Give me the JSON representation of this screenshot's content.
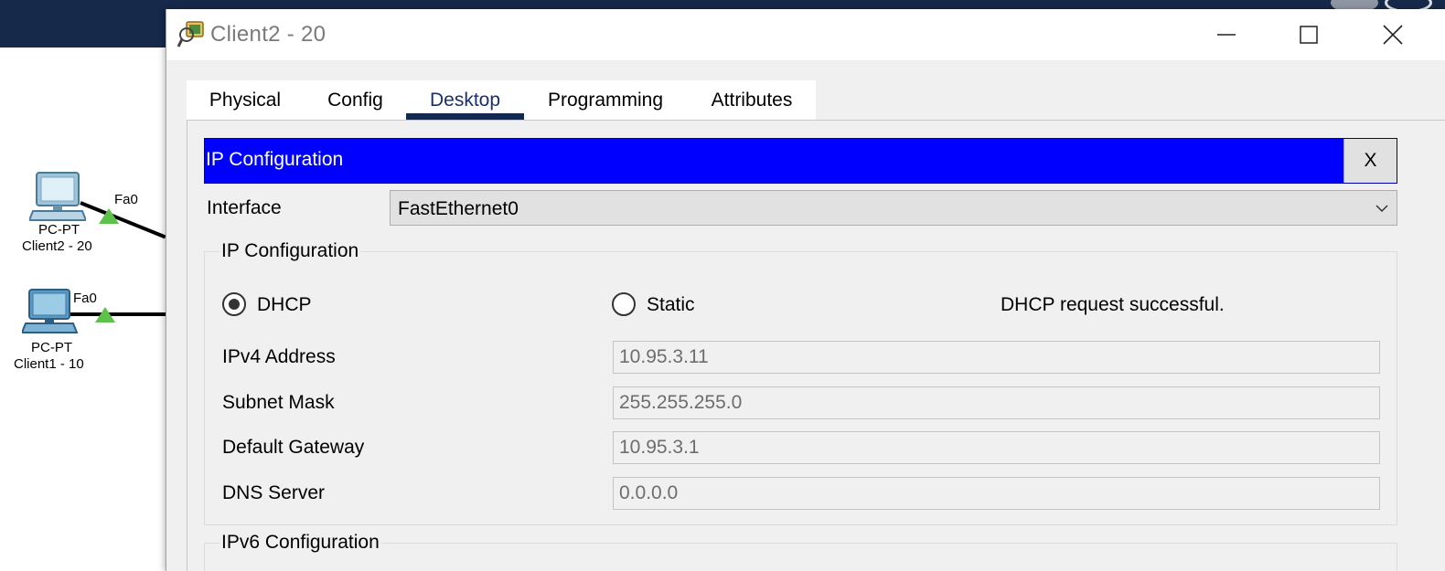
{
  "window": {
    "title": "Client2 - 20"
  },
  "tabs": [
    {
      "label": "Physical"
    },
    {
      "label": "Config"
    },
    {
      "label": "Desktop",
      "active": true
    },
    {
      "label": "Programming"
    },
    {
      "label": "Attributes"
    }
  ],
  "ip_configuration": {
    "header_title": "IP Configuration",
    "close_label": "X",
    "interface_label": "Interface",
    "interface_value": "FastEthernet0",
    "ipv4_group_title": "IP Configuration",
    "dhcp_label": "DHCP",
    "static_label": "Static",
    "mode_selected": "DHCP",
    "status_message": "DHCP request successful.",
    "fields": [
      {
        "label": "IPv4 Address",
        "value": "10.95.3.11"
      },
      {
        "label": "Subnet Mask",
        "value": "255.255.255.0"
      },
      {
        "label": "Default Gateway",
        "value": "10.95.3.1"
      },
      {
        "label": "DNS Server",
        "value": "0.0.0.0"
      }
    ],
    "ipv6_group_title": "IPv6 Configuration"
  },
  "topology": {
    "devices": [
      {
        "type": "PC-PT",
        "name": "Client2 - 20",
        "port": "Fa0"
      },
      {
        "type": "PC-PT",
        "name": "Client1 - 10",
        "port": "Fa0"
      }
    ]
  },
  "colors": {
    "header_blue": "#0000ff",
    "top_bar": "#16294a",
    "link_up": "#5cc24a",
    "active_tab_underline": "#14294f"
  }
}
